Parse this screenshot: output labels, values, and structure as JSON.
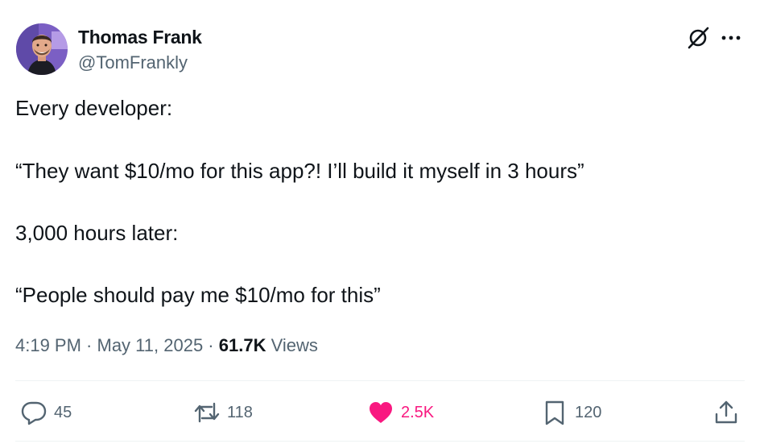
{
  "author": {
    "name": "Thomas Frank",
    "handle": "@TomFrankly"
  },
  "post": {
    "lines": [
      "Every developer:",
      "“They want $10/mo for this app?! I’ll build it myself in 3 hours”",
      "3,000 hours later:",
      "“People should pay me $10/mo for this”"
    ]
  },
  "meta": {
    "time": "4:19 PM",
    "sep1": " · ",
    "date": "May 11, 2025",
    "sep2": " · ",
    "views_count": "61.7K",
    "views_label": " Views"
  },
  "actions": {
    "replies": "45",
    "reposts": "118",
    "likes": "2.5K",
    "bookmarks": "120"
  },
  "colors": {
    "text": "#0f1419",
    "secondary": "#536471",
    "like": "#f91880",
    "divider": "#eff3f4"
  },
  "icons": [
    "grok-icon",
    "more-icon",
    "reply-icon",
    "repost-icon",
    "like-icon",
    "bookmark-icon",
    "share-icon"
  ]
}
